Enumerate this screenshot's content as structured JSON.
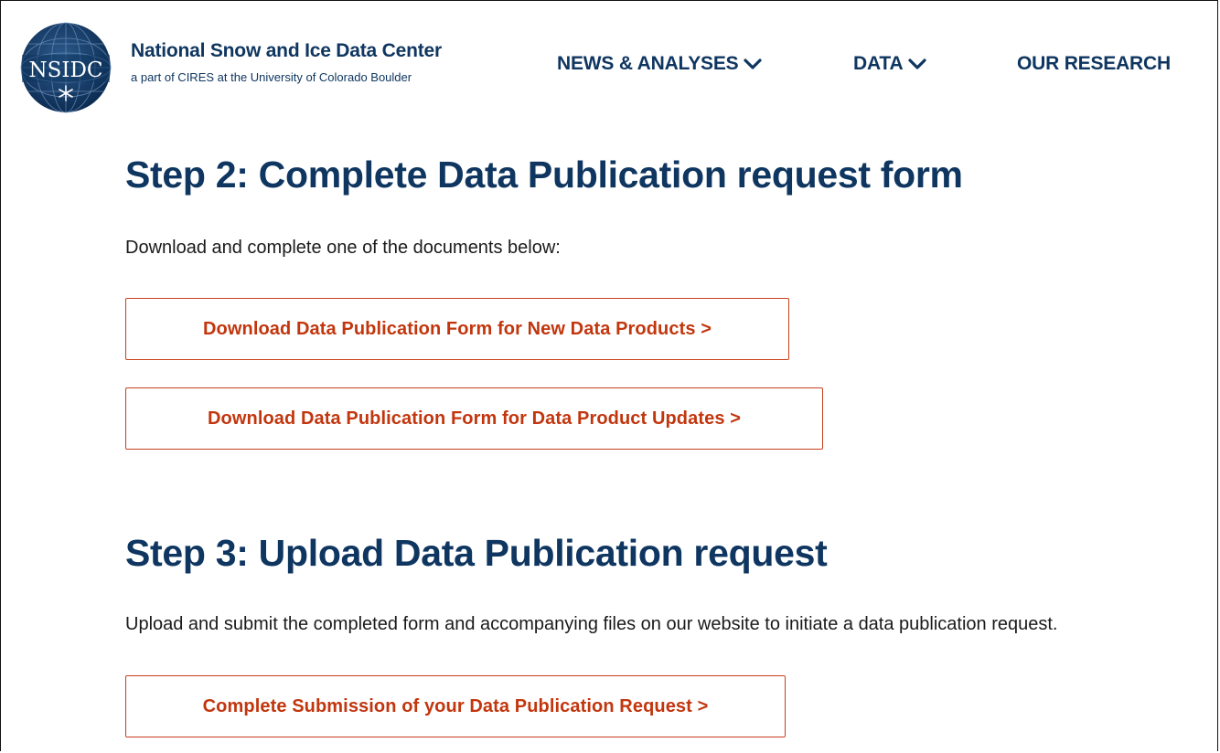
{
  "header": {
    "logo_text": "NSIDC",
    "org_name": "National Snow and Ice Data Center",
    "org_subtitle": "a part of CIRES at the University of Colorado Boulder",
    "nav": [
      {
        "label": "NEWS & ANALYSES",
        "icon": "chevron-down-icon"
      },
      {
        "label": "DATA",
        "icon": "chevron-down-icon"
      },
      {
        "label": "OUR RESEARCH"
      }
    ]
  },
  "step2": {
    "heading": "Step 2: Complete Data Publication request form",
    "text": "Download and complete one of the documents below:",
    "buttons": [
      {
        "label": "Download Data Publication Form for New Data Products >"
      },
      {
        "label": "Download Data Publication Form for Data Product Updates >"
      }
    ]
  },
  "step3": {
    "heading": "Step 3: Upload Data Publication request",
    "text": "Upload and submit the completed form and accompanying files on our website to initiate a data publication request.",
    "buttons": [
      {
        "label": "Complete Submission of your Data Publication Request >"
      }
    ]
  },
  "colors": {
    "brand_navy": "#0f3660",
    "link_orange": "#c2360e",
    "button_border": "#c8401c"
  }
}
